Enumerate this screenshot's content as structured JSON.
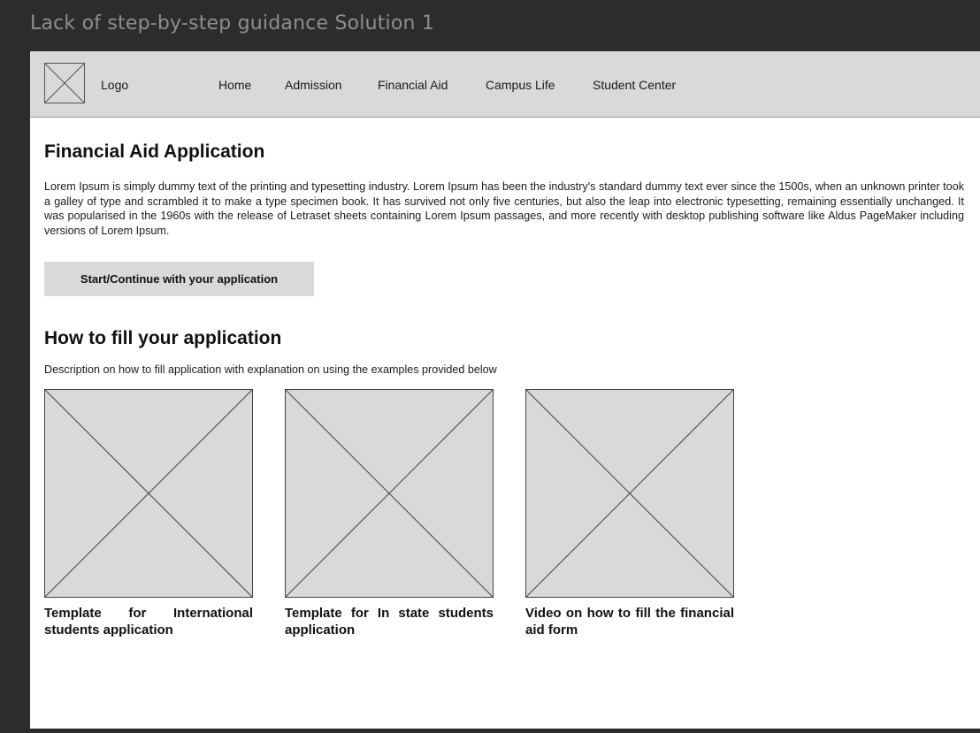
{
  "frame": {
    "title": "Lack of step-by-step guidance Solution 1"
  },
  "nav": {
    "logo_label": "Logo",
    "items": [
      {
        "label": "Home"
      },
      {
        "label": "Admission"
      },
      {
        "label": "Financial Aid"
      },
      {
        "label": "Campus Life"
      },
      {
        "label": "Student Center"
      }
    ]
  },
  "main": {
    "title": "Financial Aid Application",
    "intro": "Lorem Ipsum is simply dummy text of the printing and typesetting industry. Lorem Ipsum has been the industry's standard dummy text ever since the 1500s, when an unknown printer took a galley of type and scrambled it to make a type specimen book. It has survived not only five centuries, but also the leap into electronic typesetting, remaining essentially unchanged. It was popularised in the 1960s with the release of Letraset sheets containing Lorem Ipsum passages, and more recently with desktop publishing software like Aldus PageMaker including versions of Lorem Ipsum.",
    "start_button": "Start/Continue with your application"
  },
  "guide": {
    "title": "How to fill your application",
    "description": "Description on how to fill application with explanation on using the examples provided below",
    "cards": [
      {
        "caption": "Template for International students application"
      },
      {
        "caption": "Template for In state students application"
      },
      {
        "caption": "Video on how to fill the financial aid form"
      }
    ]
  },
  "colors": {
    "outer_background": "#2c2c2c",
    "placeholder_fill": "#d9d9d9",
    "canvas": "#ffffff"
  }
}
